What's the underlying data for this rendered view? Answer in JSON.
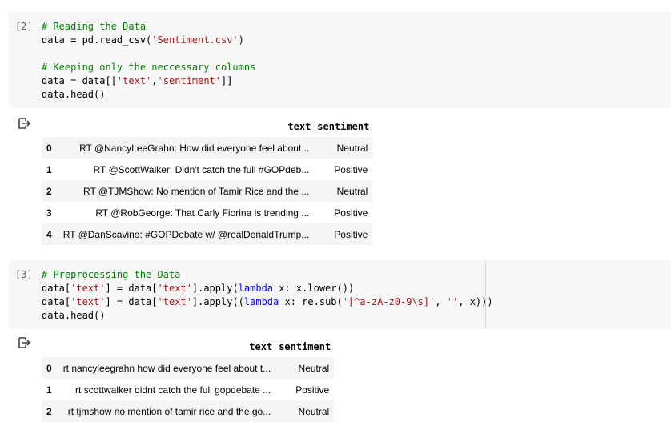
{
  "cell1": {
    "prompt": "[2]",
    "lines": [
      [
        {
          "t": "# Reading the Data",
          "c": "cm"
        }
      ],
      [
        {
          "t": "data = pd.read_csv(",
          "c": ""
        },
        {
          "t": "'Sentiment.csv'",
          "c": "st"
        },
        {
          "t": ")",
          "c": ""
        }
      ],
      [
        {
          "t": "",
          "c": ""
        }
      ],
      [
        {
          "t": "# Keeping only the neccessary columns",
          "c": "cm"
        }
      ],
      [
        {
          "t": "data = data[[",
          "c": ""
        },
        {
          "t": "'text'",
          "c": "st"
        },
        {
          "t": ",",
          "c": ""
        },
        {
          "t": "'sentiment'",
          "c": "st"
        },
        {
          "t": "]]",
          "c": ""
        }
      ],
      [
        {
          "t": "data.head()",
          "c": ""
        }
      ]
    ]
  },
  "output1": {
    "headers": [
      "",
      "text",
      "sentiment"
    ],
    "rows": [
      [
        "0",
        "RT @NancyLeeGrahn: How did everyone feel about...",
        "Neutral"
      ],
      [
        "1",
        "RT @ScottWalker: Didn't catch the full #GOPdeb...",
        "Positive"
      ],
      [
        "2",
        "RT @TJMShow: No mention of Tamir Rice and the ...",
        "Neutral"
      ],
      [
        "3",
        "RT @RobGeorge: That Carly Fiorina is trending ...",
        "Positive"
      ],
      [
        "4",
        "RT @DanScavino: #GOPDebate w/ @realDonaldTrump...",
        "Positive"
      ]
    ]
  },
  "cell2": {
    "prompt": "[3]",
    "lines": [
      [
        {
          "t": "# Preprocessing the Data",
          "c": "cm"
        }
      ],
      [
        {
          "t": "data[",
          "c": ""
        },
        {
          "t": "'text'",
          "c": "st"
        },
        {
          "t": "] = data[",
          "c": ""
        },
        {
          "t": "'text'",
          "c": "st"
        },
        {
          "t": "].apply(",
          "c": ""
        },
        {
          "t": "lambda",
          "c": "kw"
        },
        {
          "t": " x: x.lower())",
          "c": ""
        }
      ],
      [
        {
          "t": "data[",
          "c": ""
        },
        {
          "t": "'text'",
          "c": "st"
        },
        {
          "t": "] = data[",
          "c": ""
        },
        {
          "t": "'text'",
          "c": "st"
        },
        {
          "t": "].apply((",
          "c": ""
        },
        {
          "t": "lambda",
          "c": "kw"
        },
        {
          "t": " x: re.sub(",
          "c": ""
        },
        {
          "t": "'[^a-zA-z0-9\\s]'",
          "c": "st"
        },
        {
          "t": ", ",
          "c": ""
        },
        {
          "t": "''",
          "c": "st"
        },
        {
          "t": ", x)))",
          "c": ""
        }
      ],
      [
        {
          "t": "data.head()",
          "c": ""
        }
      ]
    ]
  },
  "output2": {
    "headers": [
      "",
      "text",
      "sentiment"
    ],
    "rows": [
      [
        "0",
        "rt nancyleegrahn how did everyone feel about t...",
        "Neutral"
      ],
      [
        "1",
        "rt scottwalker didnt catch the full gopdebate ...",
        "Positive"
      ],
      [
        "2",
        "rt tjmshow no mention of tamir rice and the go...",
        "Neutral"
      ]
    ]
  },
  "colors": {
    "cell_bg": "#f7f7f7",
    "comment": "#008000",
    "string": "#a31515",
    "keyword": "#0000ff"
  },
  "icons": {
    "output": "output-arrow-icon"
  }
}
